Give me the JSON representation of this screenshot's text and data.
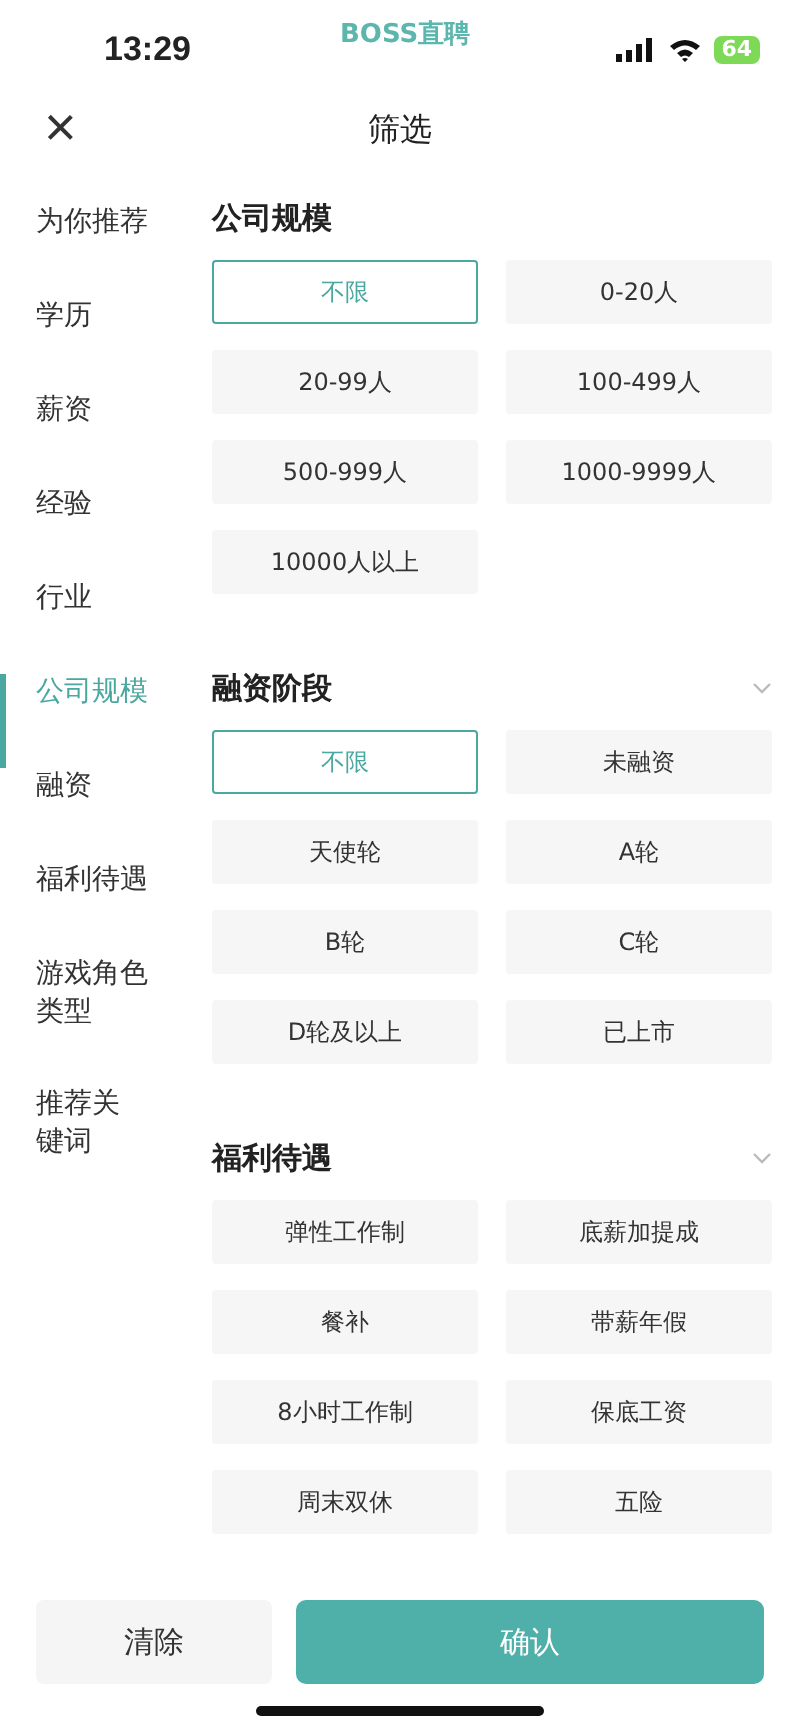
{
  "status_bar": {
    "time": "13:29",
    "app_label": "BOSS直聘",
    "battery": "64"
  },
  "header": {
    "close": "×",
    "title": "筛选"
  },
  "sidebar": {
    "items": [
      {
        "label": "为你推荐",
        "selected": false
      },
      {
        "label": "学历",
        "selected": false
      },
      {
        "label": "薪资",
        "selected": false
      },
      {
        "label": "经验",
        "selected": false
      },
      {
        "label": "行业",
        "selected": false
      },
      {
        "label": "公司规模",
        "selected": true
      },
      {
        "label": "融资",
        "selected": false
      },
      {
        "label": "福利待遇",
        "selected": false
      },
      {
        "label": "游戏角色类型",
        "selected": false
      },
      {
        "label": "推荐关键词",
        "selected": false
      }
    ]
  },
  "sections": [
    {
      "title": "公司规模",
      "chevron": false,
      "options": [
        {
          "label": "不限",
          "selected": true
        },
        {
          "label": "0-20人",
          "selected": false
        },
        {
          "label": "20-99人",
          "selected": false
        },
        {
          "label": "100-499人",
          "selected": false
        },
        {
          "label": "500-999人",
          "selected": false
        },
        {
          "label": "1000-9999人",
          "selected": false
        },
        {
          "label": "10000人以上",
          "selected": false
        }
      ]
    },
    {
      "title": "融资阶段",
      "chevron": true,
      "options": [
        {
          "label": "不限",
          "selected": true
        },
        {
          "label": "未融资",
          "selected": false
        },
        {
          "label": "天使轮",
          "selected": false
        },
        {
          "label": "A轮",
          "selected": false
        },
        {
          "label": "B轮",
          "selected": false
        },
        {
          "label": "C轮",
          "selected": false
        },
        {
          "label": "D轮及以上",
          "selected": false
        },
        {
          "label": "已上市",
          "selected": false
        }
      ]
    },
    {
      "title": "福利待遇",
      "chevron": true,
      "options": [
        {
          "label": "弹性工作制",
          "selected": false
        },
        {
          "label": "底薪加提成",
          "selected": false
        },
        {
          "label": "餐补",
          "selected": false
        },
        {
          "label": "带薪年假",
          "selected": false
        },
        {
          "label": "8小时工作制",
          "selected": false
        },
        {
          "label": "保底工资",
          "selected": false
        },
        {
          "label": "周末双休",
          "selected": false
        },
        {
          "label": "五险",
          "selected": false
        }
      ]
    }
  ],
  "footer": {
    "clear": "清除",
    "confirm": "确认"
  }
}
